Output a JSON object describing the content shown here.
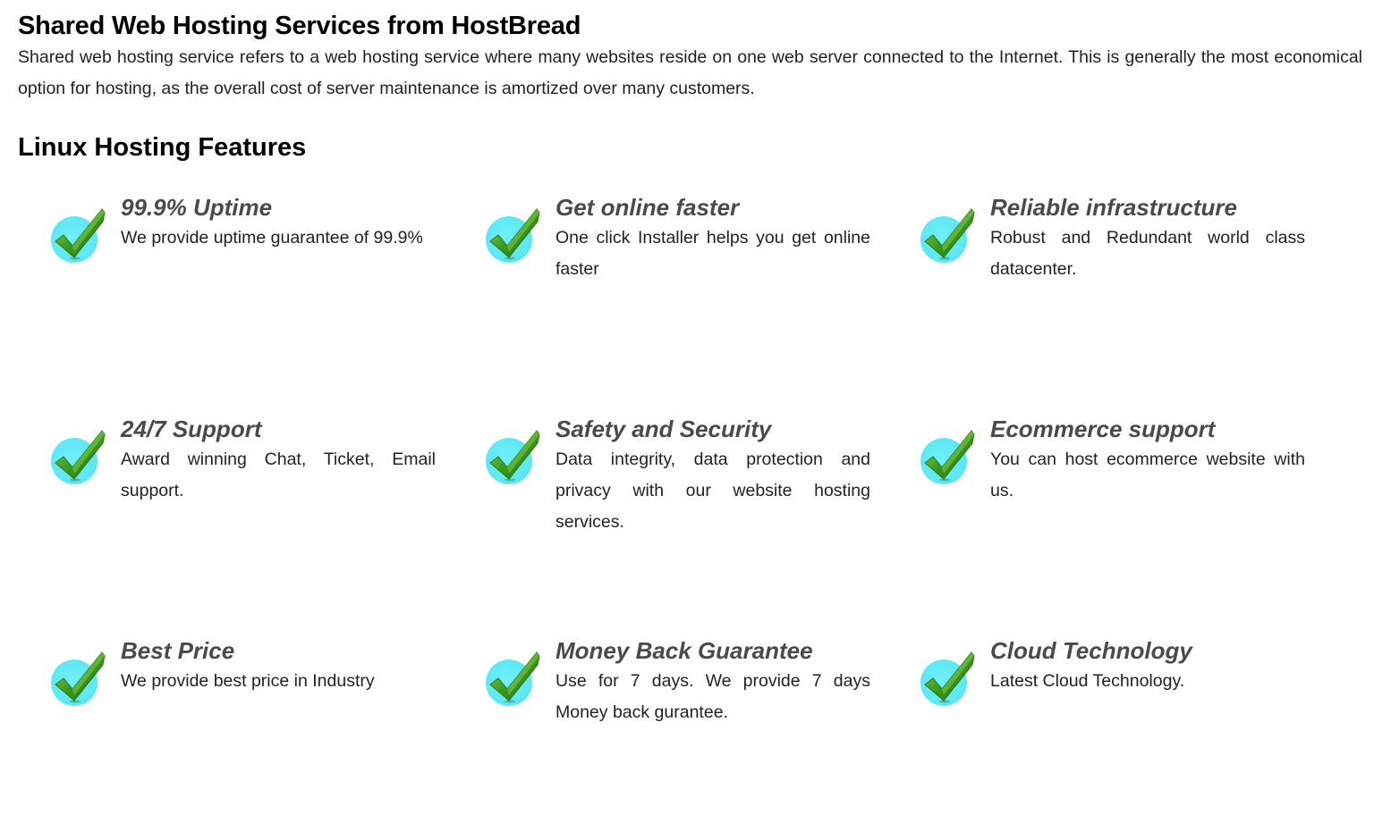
{
  "header": {
    "title": "Shared Web Hosting Services from HostBread",
    "intro": "Shared web hosting service refers to a web hosting service where many websites reside on one web server connected to the Internet. This is generally the most economical option for hosting, as the overall cost of server maintenance is amortized over many customers."
  },
  "features_section": {
    "title": "Linux Hosting Features",
    "icon": "checkmark-icon",
    "colors": {
      "icon_circle": "#6ef0fb",
      "check_green": "#3c9a1e",
      "feature_title": "#4a4a4a"
    },
    "items": [
      {
        "title": "99.9% Uptime",
        "description": "We provide uptime guarantee of 99.9%"
      },
      {
        "title": "Get online faster",
        "description": "One click Installer helps you get online faster"
      },
      {
        "title": "Reliable infrastructure",
        "description": "Robust and Redundant world class datacenter."
      },
      {
        "title": "24/7 Support",
        "description": "Award winning Chat, Ticket, Email support."
      },
      {
        "title": "Safety and Security",
        "description": "Data integrity, data protection and privacy with our website hosting services."
      },
      {
        "title": "Ecommerce support",
        "description": "You can host ecommerce website with us."
      },
      {
        "title": "Best Price",
        "description": "We provide best price in Industry"
      },
      {
        "title": "Money Back Guarantee",
        "description": "Use for 7 days. We provide 7 days Money back gurantee."
      },
      {
        "title": "Cloud Technology",
        "description": "Latest Cloud Technology."
      }
    ]
  }
}
